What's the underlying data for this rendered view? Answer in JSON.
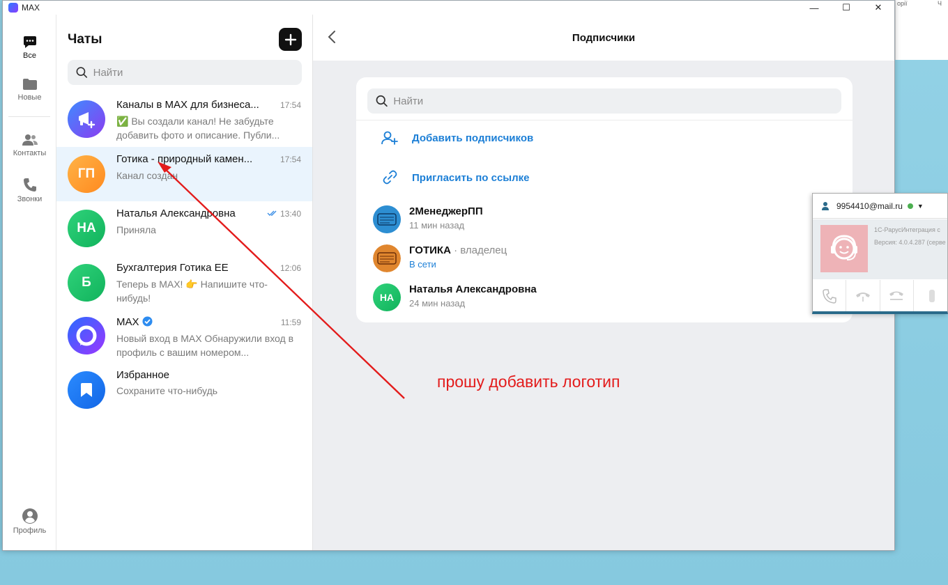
{
  "window": {
    "title": "MAX",
    "minimize": "—",
    "maximize": "☐",
    "close": "✕"
  },
  "background_tabs": [
    "орії",
    "Ч"
  ],
  "nav": {
    "all": "Все",
    "new": "Новые",
    "contacts": "Контакты",
    "calls": "Звонки",
    "profile": "Профиль"
  },
  "chats": {
    "title": "Чаты",
    "search_placeholder": "Найти",
    "items": [
      {
        "name": "Каналы в MAX для бизнеса...",
        "time": "17:54",
        "preview": "✅ Вы создали канал!  Не забудьте добавить фото и описание. Публи..."
      },
      {
        "name": "Готика - природный камен...",
        "time": "17:54",
        "preview": "Канал создан",
        "initials": "ГП"
      },
      {
        "name": "Наталья Александровна",
        "time": "13:40",
        "preview": "Приняла",
        "initials": "НА"
      },
      {
        "name": "Бухгалтерия Готика ЕЕ",
        "time": "12:06",
        "preview": "Теперь в MAX! 👉 Напишите что-нибудь!",
        "initials": "Б"
      },
      {
        "name": "MAX",
        "time": "11:59",
        "preview": "Новый вход в MAX  Обнаружили вход в профиль с вашим номером..."
      },
      {
        "name": "Избранное",
        "time": "",
        "preview": "Сохраните что-нибудь"
      }
    ]
  },
  "colors": {
    "accent": "#1c7fd6",
    "annotation": "#e31b1b",
    "online": "#4caf50"
  },
  "subscribers": {
    "title": "Подписчики",
    "search_placeholder": "Найти",
    "add_label": "Добавить подписчиков",
    "invite_label": "Пригласить по ссылке",
    "members": [
      {
        "name": "2МенеджерПП",
        "role": "",
        "status": "11 мин назад"
      },
      {
        "name": "ГОТИКА",
        "role": " · владелец",
        "status": "В сети"
      },
      {
        "name": "Наталья Александровна",
        "role": "",
        "status": "24 мин назад",
        "initials": "НА"
      }
    ]
  },
  "annotation": {
    "text": "прошу добавить логотип"
  },
  "widget": {
    "email": "9954410@mail.ru",
    "app_name": "1С-РарусИнтеграция с",
    "version": "Версия: 4.0.4.287 (серве"
  }
}
